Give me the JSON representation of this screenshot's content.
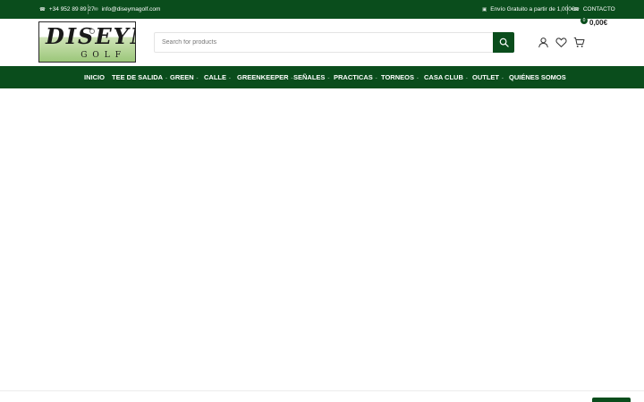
{
  "topbar": {
    "phone": "+34 952 89 89 27",
    "email": "info@diseymagolf.com",
    "shipping": "Envío Gratuito a partir de 1,000€",
    "contact": "CONTACTO"
  },
  "logo": {
    "main_text": "DISEYMA",
    "sub_text": "GOLF"
  },
  "search": {
    "placeholder": "Search for products"
  },
  "cart": {
    "count": "0",
    "total": "0,00€"
  },
  "nav": {
    "items": [
      {
        "label": "INICIO"
      },
      {
        "label": "TEE DE SALIDA"
      },
      {
        "label": "GREEN"
      },
      {
        "label": "CALLE"
      },
      {
        "label": "GREENKEEPER"
      },
      {
        "label": "SEÑALES"
      },
      {
        "label": "PRACTICAS"
      },
      {
        "label": "TORNEOS"
      },
      {
        "label": "CASA CLUB"
      },
      {
        "label": "OUTLET"
      },
      {
        "label": "QUIÉNES SOMOS"
      }
    ]
  },
  "colors": {
    "brand_green": "#0a4d1c"
  },
  "icons": {
    "phone": "phone-icon",
    "email": "envelope-icon",
    "shipping": "truck-icon",
    "contact": "phone-icon",
    "search": "search-icon",
    "account": "user-icon",
    "wishlist": "heart-icon",
    "cart": "cart-icon"
  }
}
